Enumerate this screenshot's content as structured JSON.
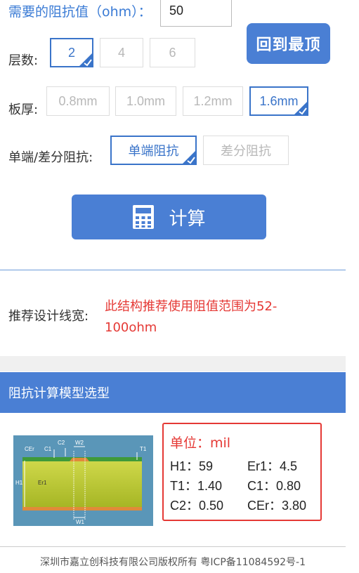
{
  "impedance": {
    "label": "需要的阻抗值（ohm）：",
    "value": "50"
  },
  "back_to_top": "回到最顶",
  "layers": {
    "label": "层数:",
    "options": [
      "2",
      "4",
      "6"
    ],
    "selected": "2"
  },
  "thickness": {
    "label": "板厚:",
    "options": [
      "0.8mm",
      "1.0mm",
      "1.2mm",
      "1.6mm"
    ],
    "selected": "1.6mm"
  },
  "mode": {
    "label": "单端/差分阻抗:",
    "options": [
      "单端阻抗",
      "差分阻抗"
    ],
    "selected": "单端阻抗"
  },
  "calculate_button": "计算",
  "recommend": {
    "label": "推荐设计线宽:",
    "value": "此结构推荐使用阻值范围为52-100ohm"
  },
  "model_section_title": "阻抗计算模型选型",
  "diagram_labels": {
    "cer": "CEr",
    "c1": "C1",
    "c2": "C2",
    "w2": "W2",
    "t1": "T1",
    "h1": "H1",
    "er1": "Er1",
    "w1": "W1"
  },
  "params": {
    "unit": "单位：mil",
    "H1": "H1：59",
    "Er1": "Er1：4.5",
    "T1": "T1：1.40",
    "C1": "C1：0.80",
    "C2": "C2：0.50",
    "CEr": "CEr：3.80"
  },
  "footer": "深圳市嘉立创科技有限公司版权所有 粤ICP备11084592号-1",
  "colors": {
    "primary": "#4a7fd4",
    "selected_border": "#3a74c9",
    "highlight_red": "#e53935"
  }
}
